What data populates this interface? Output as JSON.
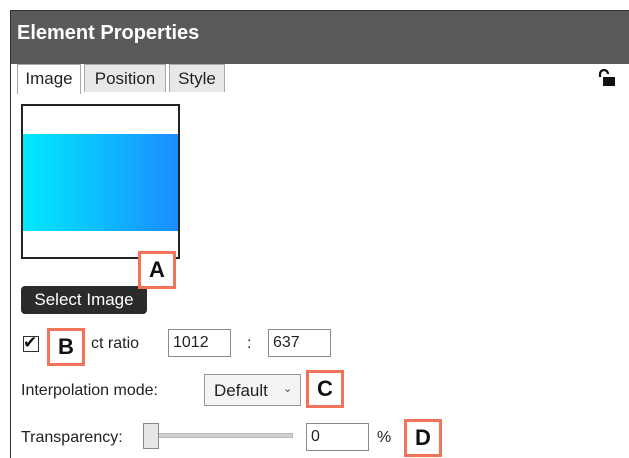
{
  "panel": {
    "title": "Element Properties",
    "tabs": [
      {
        "label": "Image",
        "active": true
      },
      {
        "label": "Position",
        "active": false
      },
      {
        "label": "Style",
        "active": false
      }
    ],
    "lock_icon": "unlocked-padlock-icon"
  },
  "image": {
    "gradient_colors": [
      "#00eaff",
      "#1a8dff"
    ],
    "select_button_label": "Select Image"
  },
  "aspect_ratio": {
    "checked": true,
    "label_visible": "ct ratio",
    "width_value": "1012",
    "separator": ":",
    "height_value": "637"
  },
  "interpolation": {
    "label": "Interpolation mode:",
    "selected": "Default"
  },
  "transparency": {
    "label": "Transparency:",
    "slider_level": 0,
    "value": "0",
    "unit": "%"
  },
  "callouts": [
    "A",
    "B",
    "C",
    "D"
  ],
  "colors": {
    "titlebar": "#5a5a5a",
    "callout_border": "#f0735a",
    "button": "#2b2b2b"
  }
}
